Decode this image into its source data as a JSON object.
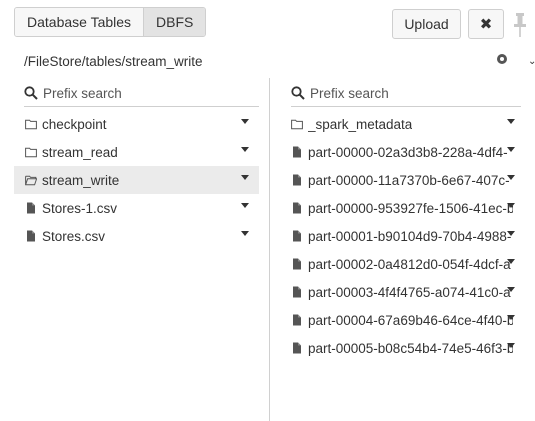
{
  "tabs": [
    {
      "label": "Database Tables",
      "active": false
    },
    {
      "label": "DBFS",
      "active": true
    }
  ],
  "toolbar": {
    "upload_label": "Upload",
    "close_label": "✖"
  },
  "path": "/FileStore/tables/stream_write",
  "left_panel": {
    "search_placeholder": "Prefix search",
    "items": [
      {
        "name": "checkpoint",
        "type": "folder"
      },
      {
        "name": "stream_read",
        "type": "folder"
      },
      {
        "name": "stream_write",
        "type": "folder-open",
        "selected": true
      },
      {
        "name": "Stores-1.csv",
        "type": "file"
      },
      {
        "name": "Stores.csv",
        "type": "file"
      }
    ]
  },
  "right_panel": {
    "search_placeholder": "Prefix search",
    "items": [
      {
        "name": "_spark_metadata",
        "type": "folder"
      },
      {
        "name": "part-00000-02a3d3b8-228a-4df4-",
        "type": "file"
      },
      {
        "name": "part-00000-11a7370b-6e67-407c-",
        "type": "file"
      },
      {
        "name": "part-00000-953927fe-1506-41ec-b",
        "type": "file"
      },
      {
        "name": "part-00001-b90104d9-70b4-4988-",
        "type": "file"
      },
      {
        "name": "part-00002-0a4812d0-054f-4dcf-a",
        "type": "file"
      },
      {
        "name": "part-00003-4f4f4765-a074-41c0-a",
        "type": "file"
      },
      {
        "name": "part-00004-67a69b46-64ce-4f40-b",
        "type": "file"
      },
      {
        "name": "part-00005-b08c54b4-74e5-46f3-b",
        "type": "file"
      }
    ]
  },
  "colors": {
    "selected_row": "#ebebeb",
    "border": "#cfcfcf",
    "text": "#333333"
  }
}
